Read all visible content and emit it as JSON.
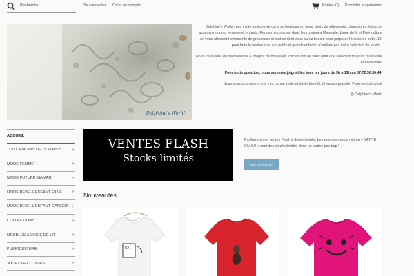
{
  "header": {
    "search_placeholder": "Rechercher",
    "login_label": "Se connecter",
    "register_label": "Créer un compte",
    "cart_label": "Panier (0)",
    "checkout_label": "Procéder au paiement"
  },
  "hero": {
    "signature": "Delphine's World"
  },
  "intro": {
    "p1": "Delphine's World vous invite à découvrir dans sa boutique un large choix de vêtements, chaussures, bijoux et accessoires pour femmes et enfants. Rendez-vous aussi dans les rubriques Maternité, Linge de lit et Puériculture où vous attendent vêtements de grossesse et tout ce dont vous aurez besoin pour préparer l'arrivée de bébé. Et, pour faire le bonheur de vos petits et grands enfants, n'oubliez pas notre sélection de jouets !",
    "p2": "Nous travaillons en permanence à intégrer de nouveaux articles afin de vous offrir une sélection toujours plus vaste et diversifiée.",
    "p3": "Pour toute question, nous sommes joignables tous les jours de 9h à 19h au 07.72.36.36.44.",
    "p4": "Nous vous souhaitons une très bonne visite et à très bientôt. Livraison gratuite, Paiement sécurisé",
    "p5": "@ Delphine's World"
  },
  "sidebar": {
    "heading": "ACCUEIL",
    "items": [
      {
        "label": "TOUT A MOINS DE 15 EUROS",
        "plus": "+"
      },
      {
        "label": "MODE FEMME",
        "plus": "+"
      },
      {
        "label": "MODE FUTURE MAMAN",
        "plus": "+"
      },
      {
        "label": "MODE BEBE & ENFANT FILLE",
        "plus": "+"
      },
      {
        "label": "MODE BEBE & ENFANT GARCON",
        "plus": "+"
      },
      {
        "label": "COLLECTIONS",
        "plus": "+"
      },
      {
        "label": "MEUBLES & LINGE DE LIT",
        "plus": "+"
      },
      {
        "label": "PUERICULTURE",
        "plus": "+"
      },
      {
        "label": "JOUETS ET LOISIRS",
        "plus": "+"
      }
    ]
  },
  "flash": {
    "banner_title": "VENTES FLASH",
    "banner_subtitle": "Stocks limités",
    "text_part1": "Profitez de ces ventes Flash à durée limitée. Les produits concernés en «",
    "text_emph1": "VENTE FLASH",
    "text_part2": "» sont des",
    "text_emph2": "stocks limités",
    "text_part3": ", donc ne tardez pas trop !",
    "button_label": "VENTES FLASH"
  },
  "new_arrivals": {
    "title": "Nouveautés",
    "products": [
      {
        "color": "#f4f4f4",
        "print": "tea-bag"
      },
      {
        "color": "#d8242c",
        "print": "cat"
      },
      {
        "color": "#e0147a",
        "print": "smiley"
      }
    ]
  },
  "colors": {
    "accent_button": "#7aa7c7",
    "banner_bg": "#000000"
  }
}
